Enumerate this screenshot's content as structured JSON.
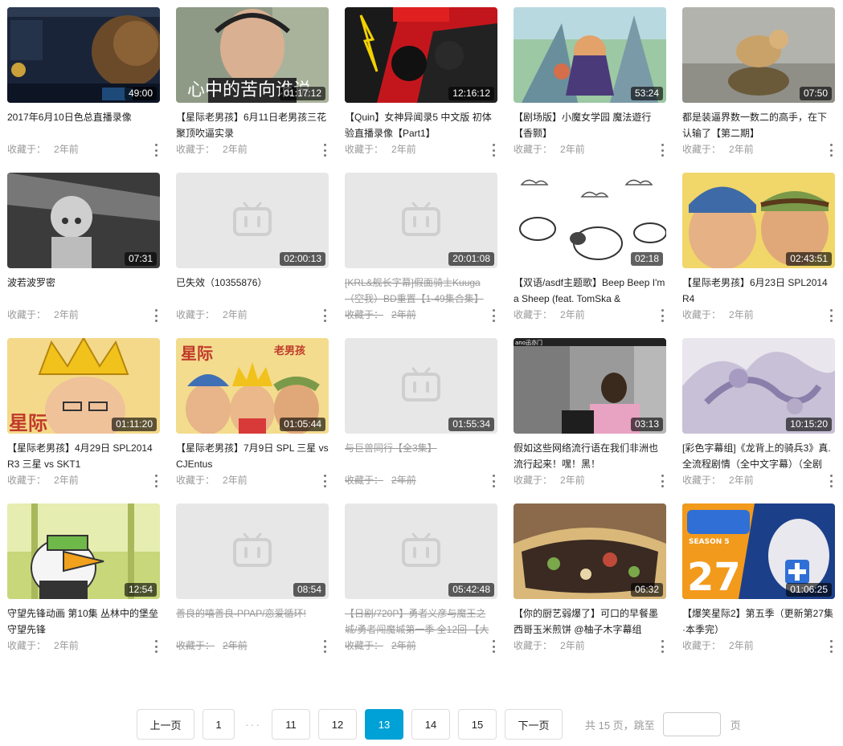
{
  "placeholder_color": "#e7e7e7",
  "accent_color": "#00a1d6",
  "cards": [
    {
      "title": "2017年6月10日色总直播录像",
      "duration": "49:00",
      "meta_label": "收藏于：",
      "meta_time": "2年前",
      "invalid": false
    },
    {
      "title": "【星际老男孩】6月11日老男孩三花聚顶吹逼实录",
      "duration": "01:17:12",
      "meta_label": "收藏于：",
      "meta_time": "2年前",
      "invalid": false
    },
    {
      "title": "【Quin】女神异闻录5 中文版 初体验直播录像【Part1】",
      "duration": "12:16:12",
      "meta_label": "收藏于：",
      "meta_time": "2年前",
      "invalid": false
    },
    {
      "title": "【剧场版】小魔女学园 魔法遊行【香颢】",
      "duration": "53:24",
      "meta_label": "收藏于：",
      "meta_time": "2年前",
      "invalid": false
    },
    {
      "title": "都是装逼界数一数二的高手，在下认输了【第二期】",
      "duration": "07:50",
      "meta_label": "收藏于：",
      "meta_time": "2年前",
      "invalid": false
    },
    {
      "title": "波若波罗密",
      "duration": "07:31",
      "meta_label": "收藏于：",
      "meta_time": "2年前",
      "invalid": false
    },
    {
      "title": "已失效（10355876）",
      "duration": "02:00:13",
      "meta_label": "收藏于：",
      "meta_time": "2年前",
      "invalid": false
    },
    {
      "title": "[KRL&舰长字幕]假面骑士Kuuga（空我）BD重置【1-49集合集】",
      "duration": "20:01:08",
      "meta_label": "收藏于：",
      "meta_time": "2年前",
      "invalid": true
    },
    {
      "title": "【双语/asdf主题歌】Beep Beep I'm a Sheep (feat. TomSka & ",
      "duration": "02:18",
      "meta_label": "收藏于：",
      "meta_time": "2年前",
      "invalid": false
    },
    {
      "title": "【星际老男孩】6月23日 SPL2014 R4",
      "duration": "02:43:51",
      "meta_label": "收藏于：",
      "meta_time": "2年前",
      "invalid": false
    },
    {
      "title": "【星际老男孩】4月29日 SPL2014 R3 三星 vs SKT1",
      "duration": "01:11:20",
      "meta_label": "收藏于：",
      "meta_time": "2年前",
      "invalid": false
    },
    {
      "title": "【星际老男孩】7月9日 SPL 三星 vs CJEntus",
      "duration": "01:05:44",
      "meta_label": "收藏于：",
      "meta_time": "2年前",
      "invalid": false
    },
    {
      "title": "与巨兽同行【全3集】",
      "duration": "01:55:34",
      "meta_label": "收藏于：",
      "meta_time": "2年前",
      "invalid": true
    },
    {
      "title": "假如这些网络流行语在我们非洲也流行起来！嘿！黑！",
      "duration": "03:13",
      "meta_label": "收藏于：",
      "meta_time": "2年前",
      "invalid": false
    },
    {
      "title": "[彩色字幕组]《龙背上的骑兵3》真.全流程剧情（全中文字幕）（全剧",
      "duration": "10:15:20",
      "meta_label": "收藏于：",
      "meta_time": "2年前",
      "invalid": false
    },
    {
      "title": "守望先锋动画 第10集 丛林中的堡垒 守望先锋",
      "duration": "12:54",
      "meta_label": "收藏于：",
      "meta_time": "2年前",
      "invalid": false
    },
    {
      "title": "善良的嘻善良-PPAP/恋爱循环!",
      "duration": "08:54",
      "meta_label": "收藏于：",
      "meta_time": "2年前",
      "invalid": true
    },
    {
      "title": "【日剧/720P】勇者义彦与魔王之城/勇者闯魔城第一季 全12回 【大",
      "duration": "05:42:48",
      "meta_label": "收藏于：",
      "meta_time": "2年前",
      "invalid": true
    },
    {
      "title": "【你的厨艺弱爆了】可口的早餐墨西哥玉米煎饼 @柚子木字幕组",
      "duration": "06:32",
      "meta_label": "收藏于：",
      "meta_time": "2年前",
      "invalid": false
    },
    {
      "title": "【爆笑星际2】第五季（更新第27集·本季完）",
      "duration": "01:06:25",
      "meta_label": "收藏于：",
      "meta_time": "2年前",
      "invalid": false
    }
  ],
  "thumb_texts": {
    "card2_caption": "心中的苦向谁说",
    "card12_word1": "星际",
    "card12_word2": "老男孩",
    "card11_word": "星际",
    "card14_tag": "ano迅亦门",
    "card20_number": "27",
    "card20_season": "SEASON 5"
  },
  "pagination": {
    "prev": "上一页",
    "pages": [
      "1",
      "11",
      "12",
      "13",
      "14",
      "15"
    ],
    "ellipsis": "···",
    "current": "13",
    "next": "下一页",
    "total_text": "共 15 页，跳至",
    "page_suffix": "页",
    "jump_value": ""
  }
}
